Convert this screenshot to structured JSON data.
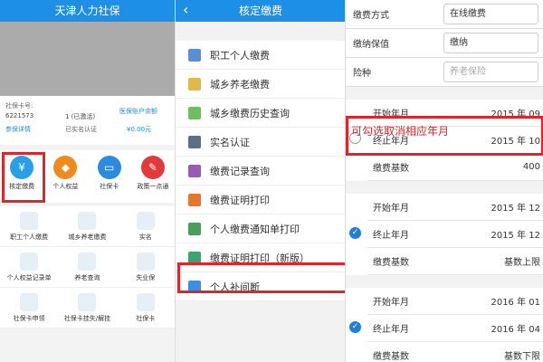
{
  "panel1": {
    "title": "天津人力社保",
    "card_label": "社保卡号:",
    "card_number": "6221573",
    "card_status": "1 (已激活)",
    "realname_status": "已实名认证",
    "detail_link": "参保详情",
    "medical_label": "医保账户余额",
    "medical_amount": "¥0.00元",
    "icons": [
      {
        "label": "核定缴费",
        "color": "#27a0e8"
      },
      {
        "label": "个人权益",
        "color": "#f08a1c"
      },
      {
        "label": "社保卡",
        "color": "#2a8be0"
      },
      {
        "label": "政策一点通",
        "color": "#e23a3a"
      }
    ],
    "grid": [
      [
        "职工个人缴费",
        "城乡养老缴费",
        "实名"
      ],
      [
        "个人权益记录单",
        "养老查询",
        "失业保"
      ],
      [
        "社保卡申领",
        "社保卡挂失/解挂",
        "社保卡"
      ]
    ]
  },
  "panel2": {
    "title": "核定缴费",
    "back": "‹",
    "items": [
      {
        "label": "职工个人缴费",
        "color": "#5a8fd6"
      },
      {
        "label": "城乡养老缴费",
        "color": "#e3b84a"
      },
      {
        "label": "城乡缴费历史查询",
        "color": "#6cbf5f"
      },
      {
        "label": "实名认证",
        "color": "#5b6f8a"
      },
      {
        "label": "缴费记录查询",
        "color": "#9b59b6"
      },
      {
        "label": "缴费证明打印",
        "color": "#e8762a"
      },
      {
        "label": "个人缴费通知单打印",
        "color": "#4a9e5c"
      },
      {
        "label": "缴费证明打印（新版）",
        "color": "#3aa66e"
      },
      {
        "label": "个人补间断",
        "color": "#3b8ee0"
      }
    ]
  },
  "panel3": {
    "form": [
      {
        "label": "缴费方式",
        "value": "在线缴费"
      },
      {
        "label": "缴纳保值",
        "value": "缴纳"
      },
      {
        "label": "险种",
        "value": "养老保险",
        "placeholder": true
      }
    ],
    "annotation": "可勾选取消相应年月",
    "blocks": [
      {
        "checked": false,
        "rows": [
          {
            "label": "开始年月",
            "value": "2015 年 09"
          },
          {
            "label": "终止年月",
            "value": "2015 年 10"
          },
          {
            "label": "缴费基数",
            "value": "400"
          }
        ]
      },
      {
        "checked": true,
        "rows": [
          {
            "label": "开始年月",
            "value": "2015 年 12"
          },
          {
            "label": "终止年月",
            "value": "2015 年 12"
          },
          {
            "label": "缴费基数",
            "value": "基数上限"
          }
        ]
      },
      {
        "checked": true,
        "rows": [
          {
            "label": "开始年月",
            "value": "2016 年 01"
          },
          {
            "label": "终止年月",
            "value": "2016 年 04"
          },
          {
            "label": "缴费基数",
            "value": "基数下限"
          }
        ]
      }
    ]
  }
}
